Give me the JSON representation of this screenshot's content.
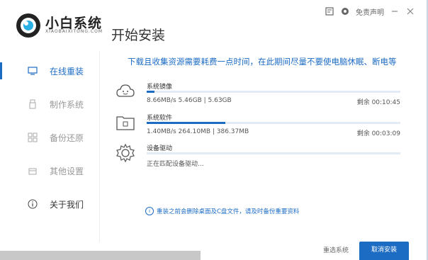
{
  "app": {
    "brand": "小白系统",
    "brand_sub": "XIAOBAIXITONG.COM",
    "page_title": "开始安装",
    "accent": "#1d6cc4"
  },
  "topbar": {
    "disclaimer": "免责声明"
  },
  "sidebar": {
    "items": [
      {
        "label": "在线重装",
        "icon": "monitor-icon",
        "active": true
      },
      {
        "label": "制作系统",
        "icon": "usb-icon",
        "active": false
      },
      {
        "label": "备份还原",
        "icon": "grid-icon",
        "active": false
      },
      {
        "label": "其他设置",
        "icon": "box-icon",
        "active": false
      },
      {
        "label": "关于我们",
        "icon": "info-icon",
        "active": false
      }
    ]
  },
  "main": {
    "headline": "下载且收集资源需要耗费一点时间，在此期间尽量不要使电脑休眠、断电等",
    "tasks": [
      {
        "name": "系统镜像",
        "info": "8.66MB/s 5.46GB | 5.63GB",
        "remaining": "剩余 00:10:45",
        "progress": 0.03,
        "icon": "cloud-icon"
      },
      {
        "name": "系统软件",
        "info": "1.40MB/s 264.10MB | 386.37MB",
        "remaining": "剩余 00:03:09",
        "progress": 0.31,
        "icon": "folder-icon"
      },
      {
        "name": "设备驱动",
        "info": "正在匹配设备驱动...",
        "remaining": "",
        "progress": 0,
        "icon": "gear-icon"
      }
    ],
    "notice": "重装之前会删除桌面及C盘文件，请及时备份重要资料"
  },
  "footer": {
    "reselect": "重选系统",
    "cancel": "取消安装"
  }
}
